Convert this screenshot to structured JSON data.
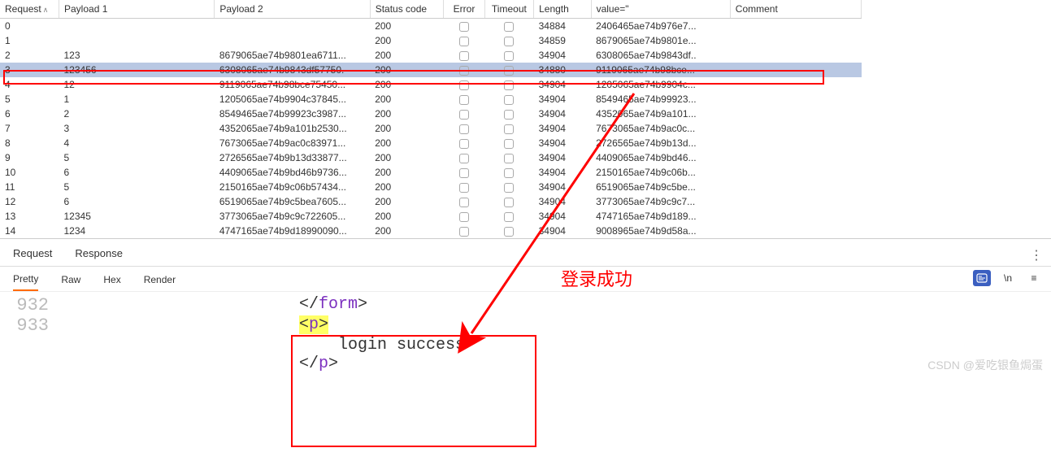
{
  "columns": {
    "request": "Request",
    "payload1": "Payload 1",
    "payload2": "Payload 2",
    "status": "Status code",
    "error": "Error",
    "timeout": "Timeout",
    "length": "Length",
    "value": "value=\"",
    "comment": "Comment"
  },
  "rows": [
    {
      "req": "0",
      "p1": "",
      "p2": "",
      "status": "200",
      "len": "34884",
      "val": "2406465ae74b976e7..."
    },
    {
      "req": "1",
      "p1": "",
      "p2": "",
      "status": "200",
      "len": "34859",
      "val": "8679065ae74b9801e..."
    },
    {
      "req": "2",
      "p1": "123",
      "p2": "8679065ae74b9801ea6711...",
      "status": "200",
      "len": "34904",
      "val": "6308065ae74b9843df.."
    },
    {
      "req": "3",
      "p1": "123456",
      "p2": "6308065ae74b9843df57750.",
      "status": "200",
      "len": "34880",
      "val": "9119065ae74b98bce...",
      "selected": true
    },
    {
      "req": "4",
      "p1": "12",
      "p2": "9119065ae74b98bce75450...",
      "status": "200",
      "len": "34904",
      "val": "1205065ae74b9904c..."
    },
    {
      "req": "5",
      "p1": "1",
      "p2": "1205065ae74b9904c37845...",
      "status": "200",
      "len": "34904",
      "val": "8549465ae74b99923..."
    },
    {
      "req": "6",
      "p1": "2",
      "p2": "8549465ae74b99923c3987...",
      "status": "200",
      "len": "34904",
      "val": "4352065ae74b9a101..."
    },
    {
      "req": "7",
      "p1": "3",
      "p2": "4352065ae74b9a101b2530...",
      "status": "200",
      "len": "34904",
      "val": "7673065ae74b9ac0c..."
    },
    {
      "req": "8",
      "p1": "4",
      "p2": "7673065ae74b9ac0c83971...",
      "status": "200",
      "len": "34904",
      "val": "2726565ae74b9b13d..."
    },
    {
      "req": "9",
      "p1": "5",
      "p2": "2726565ae74b9b13d33877...",
      "status": "200",
      "len": "34904",
      "val": "4409065ae74b9bd46..."
    },
    {
      "req": "10",
      "p1": "6",
      "p2": "4409065ae74b9bd46b9736...",
      "status": "200",
      "len": "34904",
      "val": "2150165ae74b9c06b..."
    },
    {
      "req": "11",
      "p1": "5",
      "p2": "2150165ae74b9c06b57434...",
      "status": "200",
      "len": "34904",
      "val": "6519065ae74b9c5be..."
    },
    {
      "req": "12",
      "p1": "6",
      "p2": "6519065ae74b9c5bea7605...",
      "status": "200",
      "len": "34904",
      "val": "3773065ae74b9c9c7..."
    },
    {
      "req": "13",
      "p1": "12345",
      "p2": "3773065ae74b9c9c722605...",
      "status": "200",
      "len": "34904",
      "val": "4747165ae74b9d189..."
    },
    {
      "req": "14",
      "p1": "1234",
      "p2": "4747165ae74b9d18990090...",
      "status": "200",
      "len": "34904",
      "val": "9008965ae74b9d58a..."
    }
  ],
  "mainTabs": {
    "request": "Request",
    "response": "Response"
  },
  "subTabs": {
    "pretty": "Pretty",
    "raw": "Raw",
    "hex": "Hex",
    "render": "Render"
  },
  "rightCtrls": {
    "newline": "\\n",
    "menu": "≡"
  },
  "code": {
    "line932": "932",
    "line933": "933",
    "formClose": "form",
    "pTag": "p",
    "content": "    login success"
  },
  "annotation": "登录成功",
  "watermark": "CSDN @爱吃银鱼焗蛋"
}
